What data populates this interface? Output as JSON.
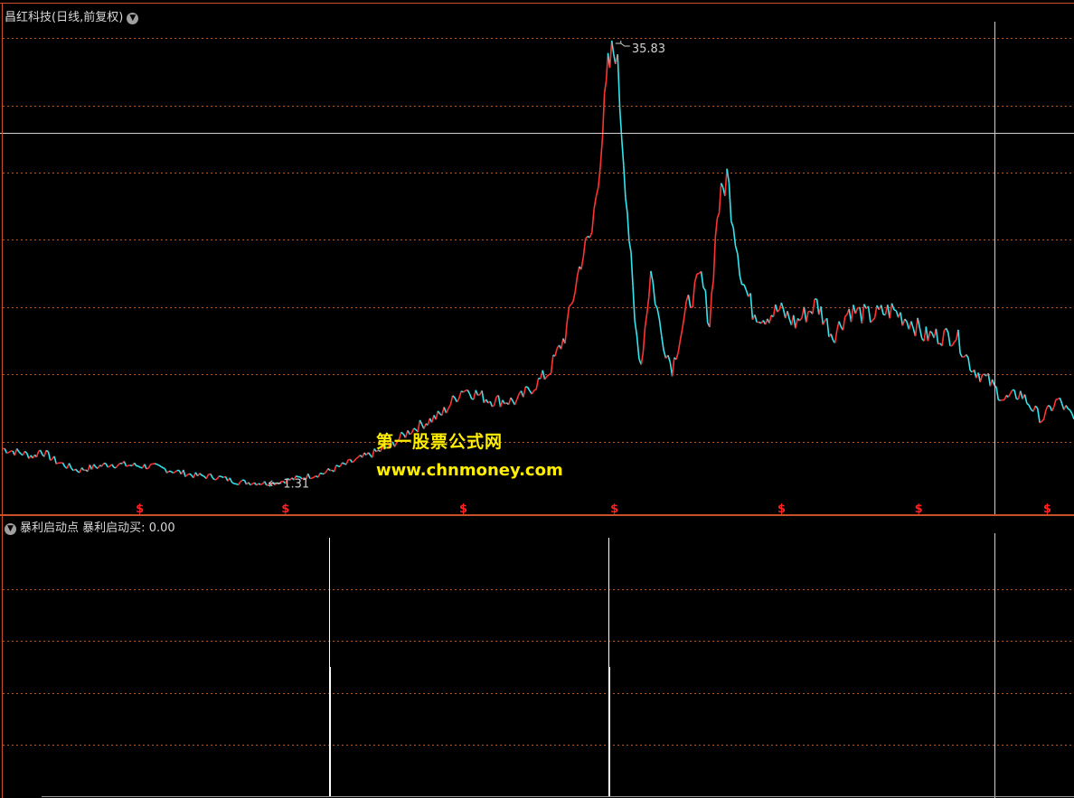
{
  "header": {
    "title": "昌红科技(日线,前复权)",
    "indicator_name": "暴利启动点",
    "indicator_series": "暴利启动买",
    "indicator_value": "0.00"
  },
  "watermark": {
    "line1": "第一股票公式网",
    "line2": "www.chnmoney.com"
  },
  "colors": {
    "background": "#000000",
    "up": "#ff3333",
    "down": "#33e6ee",
    "grid": "#b8581f",
    "border": "#c8502a",
    "crosshair": "#d0d0d0",
    "signal": "#ff2020",
    "bar": "#ffffff",
    "watermark": "#ffee00"
  },
  "chart_data": [
    {
      "type": "line",
      "title": "昌红科技(日线,前复权)",
      "ylim": [
        0,
        37
      ],
      "grid": true,
      "max_label": "35.83",
      "min_label": "1.31",
      "signal_symbol": "$",
      "signal_positions": [
        0.128,
        0.264,
        0.43,
        0.571,
        0.727,
        0.855,
        0.975
      ],
      "series": [
        {
          "x": [
            0,
            0.03,
            0.035,
            0.05,
            0.07,
            0.1,
            0.14,
            0.18,
            0.2,
            0.22,
            0.25,
            0.27,
            0.3,
            0.33,
            0.36,
            0.38,
            0.41,
            0.43,
            0.455,
            0.48,
            0.5,
            0.51,
            0.525,
            0.54,
            0.55,
            0.56,
            0.565,
            0.572,
            0.578,
            0.583,
            0.59,
            0.596,
            0.605,
            0.615,
            0.625,
            0.64,
            0.652,
            0.66,
            0.667,
            0.676,
            0.69,
            0.7,
            0.71,
            0.725,
            0.74,
            0.76,
            0.775,
            0.79,
            0.81,
            0.83,
            0.85,
            0.86,
            0.875,
            0.89,
            0.905,
            0.92,
            0.935,
            0.95,
            0.97,
            0.985,
            1.0
          ],
          "values": [
            4.2,
            3.6,
            4.1,
            3.2,
            2.5,
            3.0,
            2.8,
            2.1,
            2.0,
            1.6,
            1.5,
            1.8,
            2.3,
            3.3,
            4.3,
            5.6,
            6.9,
            8.9,
            8.0,
            7.9,
            9.4,
            10.2,
            13.0,
            19.0,
            21.0,
            29.0,
            33.5,
            35.8,
            29.0,
            23.0,
            14.0,
            10.8,
            18.0,
            13.0,
            10.5,
            15.5,
            17.5,
            14.0,
            22.5,
            25.5,
            17.5,
            15.0,
            14.5,
            15.0,
            14.0,
            15.5,
            13.0,
            15.0,
            14.5,
            15.0,
            14.0,
            13.0,
            13.0,
            13.0,
            10.5,
            9.5,
            8.0,
            8.5,
            6.5,
            8.0,
            6.5
          ]
        }
      ]
    },
    {
      "type": "bar",
      "title": "暴利启动点",
      "series": [
        {
          "name": "暴利启动买",
          "x": [
            0.305,
            0.565,
            0.927
          ],
          "values": [
            1,
            1,
            1
          ]
        }
      ]
    }
  ]
}
